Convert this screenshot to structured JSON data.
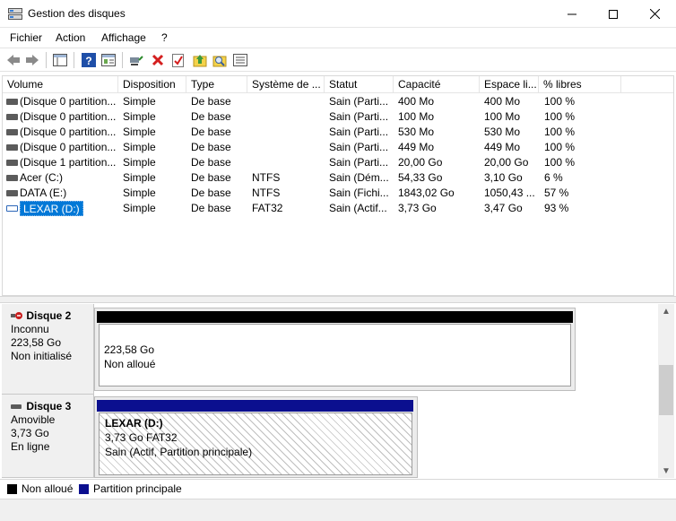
{
  "window": {
    "title": "Gestion des disques",
    "minimize_glyph": "—",
    "maximize_glyph": "☐",
    "close_glyph": "✕"
  },
  "menu": [
    "Fichier",
    "Action",
    "Affichage",
    "?"
  ],
  "toolbar": {
    "icons": [
      "back-icon",
      "forward-icon",
      "console-tree-icon",
      "help-icon",
      "properties-icon",
      "connect-icon",
      "delete-icon",
      "checklist-icon",
      "upload-icon",
      "search-icon",
      "list-view-icon"
    ]
  },
  "columns": [
    "Volume",
    "Disposition",
    "Type",
    "Système de ...",
    "Statut",
    "Capacité",
    "Espace li...",
    "% libres"
  ],
  "volumes": [
    {
      "volume": "(Disque 0 partition...",
      "disposition": "Simple",
      "type": "De base",
      "fs": "",
      "statut": "Sain (Parti...",
      "capacite": "400 Mo",
      "espace": "400 Mo",
      "libres": "100 %"
    },
    {
      "volume": "(Disque 0 partition...",
      "disposition": "Simple",
      "type": "De base",
      "fs": "",
      "statut": "Sain (Parti...",
      "capacite": "100 Mo",
      "espace": "100 Mo",
      "libres": "100 %"
    },
    {
      "volume": "(Disque 0 partition...",
      "disposition": "Simple",
      "type": "De base",
      "fs": "",
      "statut": "Sain (Parti...",
      "capacite": "530 Mo",
      "espace": "530 Mo",
      "libres": "100 %"
    },
    {
      "volume": "(Disque 0 partition...",
      "disposition": "Simple",
      "type": "De base",
      "fs": "",
      "statut": "Sain (Parti...",
      "capacite": "449 Mo",
      "espace": "449 Mo",
      "libres": "100 %"
    },
    {
      "volume": "(Disque 1 partition...",
      "disposition": "Simple",
      "type": "De base",
      "fs": "",
      "statut": "Sain (Parti...",
      "capacite": "20,00 Go",
      "espace": "20,00 Go",
      "libres": "100 %"
    },
    {
      "volume": "Acer (C:)",
      "disposition": "Simple",
      "type": "De base",
      "fs": "NTFS",
      "statut": "Sain (Dém...",
      "capacite": "54,33 Go",
      "espace": "3,10 Go",
      "libres": "6 %"
    },
    {
      "volume": "DATA (E:)",
      "disposition": "Simple",
      "type": "De base",
      "fs": "NTFS",
      "statut": "Sain (Fichi...",
      "capacite": "1843,02 Go",
      "espace": "1050,43 ...",
      "libres": "57 %"
    },
    {
      "volume": "LEXAR (D:)",
      "disposition": "Simple",
      "type": "De base",
      "fs": "FAT32",
      "statut": "Sain (Actif...",
      "capacite": "3,73 Go",
      "espace": "3,47 Go",
      "libres": "93 %"
    }
  ],
  "disks": [
    {
      "name": "Disque 2",
      "kind": "Inconnu",
      "size": "223,58 Go",
      "state": "Non initialisé",
      "partition": {
        "line1": "223,58 Go",
        "line2": "Non alloué",
        "line3": ""
      }
    },
    {
      "name": "Disque 3",
      "kind": "Amovible",
      "size": "3,73 Go",
      "state": "En ligne",
      "partition": {
        "line1": "LEXAR  (D:)",
        "line2": "3,73 Go FAT32",
        "line3": "Sain (Actif, Partition principale)"
      }
    }
  ],
  "legend": [
    {
      "label": "Non alloué",
      "color": "#000000"
    },
    {
      "label": "Partition principale",
      "color": "#0b0f8f"
    }
  ],
  "scroll": {
    "up": "▲",
    "down": "▼"
  },
  "colors": {
    "selection": "#0078d7",
    "primary_partition": "#0b0f8f",
    "unallocated": "#000000"
  }
}
